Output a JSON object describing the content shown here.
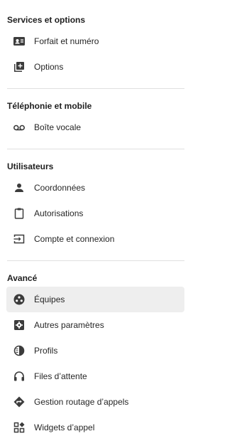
{
  "sections": [
    {
      "title": "Services et options",
      "items": [
        {
          "label": "Forfait et numéro",
          "icon": "contact-card-icon"
        },
        {
          "label": "Options",
          "icon": "add-box-icon"
        }
      ]
    },
    {
      "title": "Téléphonie et mobile",
      "items": [
        {
          "label": "Boîte vocale",
          "icon": "voicemail-icon"
        }
      ]
    },
    {
      "title": "Utilisateurs",
      "items": [
        {
          "label": "Coordonnées",
          "icon": "person-icon"
        },
        {
          "label": "Autorisations",
          "icon": "clipboard-icon"
        },
        {
          "label": "Compte et connexion",
          "icon": "login-icon"
        }
      ]
    },
    {
      "title": "Avancé",
      "items": [
        {
          "label": "Équipes",
          "icon": "team-icon",
          "active": true
        },
        {
          "label": "Autres paramètres",
          "icon": "settings-box-icon"
        },
        {
          "label": "Profils",
          "icon": "half-circle-icon"
        },
        {
          "label": "Files d’attente",
          "icon": "headset-icon"
        },
        {
          "label": "Gestion routage d’appels",
          "icon": "route-diamond-icon"
        },
        {
          "label": "Widgets d’appel",
          "icon": "widgets-icon"
        }
      ]
    }
  ],
  "colors": {
    "active_bg": "#eeeeee",
    "icon": "#3c3c3c",
    "divider": "#e0e0e0"
  }
}
